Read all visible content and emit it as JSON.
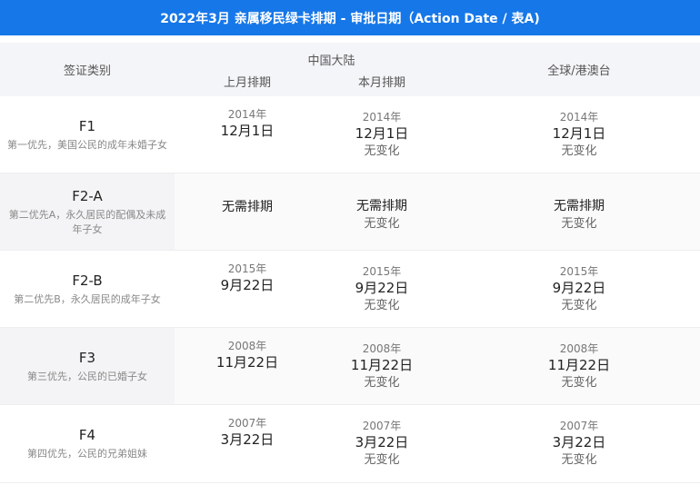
{
  "title": "2022年3月 亲属移民绿卡排期 - 审批日期（Action Date / 表A)",
  "header": {
    "category": "签证类别",
    "mainland": "中国大陆",
    "last_month": "上月排期",
    "this_month": "本月排期",
    "global": "全球/港澳台"
  },
  "rows": [
    {
      "code": "F1",
      "desc": "第一优先，美国公民的成年未婚子女",
      "last": {
        "year": "2014年",
        "date": "12月1日"
      },
      "this": {
        "year": "2014年",
        "date": "12月1日",
        "change": "无变化"
      },
      "global": {
        "year": "2014年",
        "date": "12月1日",
        "change": "无变化"
      }
    },
    {
      "code": "F2-A",
      "desc": "第二优先A，永久居民的配偶及未成年子女",
      "last": {
        "text": "无需排期"
      },
      "this": {
        "text": "无需排期",
        "change": "无变化"
      },
      "global": {
        "text": "无需排期",
        "change": "无变化"
      }
    },
    {
      "code": "F2-B",
      "desc": "第二优先B，永久居民的成年子女",
      "last": {
        "year": "2015年",
        "date": "9月22日"
      },
      "this": {
        "year": "2015年",
        "date": "9月22日",
        "change": "无变化"
      },
      "global": {
        "year": "2015年",
        "date": "9月22日",
        "change": "无变化"
      }
    },
    {
      "code": "F3",
      "desc": "第三优先，公民的已婚子女",
      "last": {
        "year": "2008年",
        "date": "11月22日"
      },
      "this": {
        "year": "2008年",
        "date": "11月22日",
        "change": "无变化"
      },
      "global": {
        "year": "2008年",
        "date": "11月22日",
        "change": "无变化"
      }
    },
    {
      "code": "F4",
      "desc": "第四优先，公民的兄弟姐妹",
      "last": {
        "year": "2007年",
        "date": "3月22日"
      },
      "this": {
        "year": "2007年",
        "date": "3月22日",
        "change": "无变化"
      },
      "global": {
        "year": "2007年",
        "date": "3月22日",
        "change": "无变化"
      }
    }
  ]
}
